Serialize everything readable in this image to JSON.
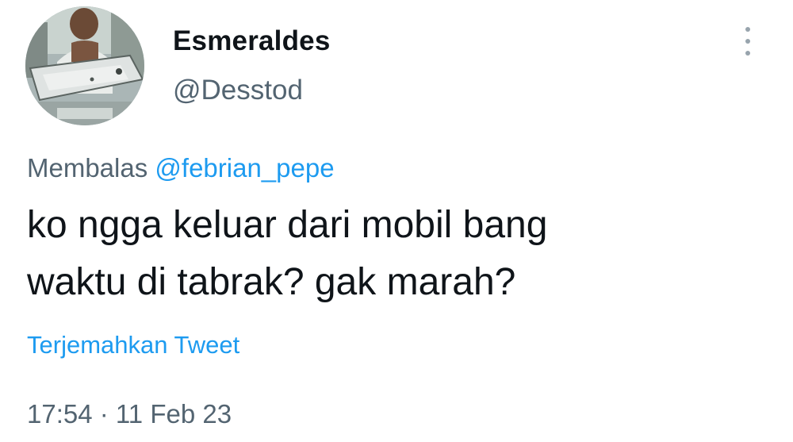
{
  "author": {
    "display_name": "Esmeraldes",
    "handle": "@Desstod",
    "avatar_icon": "profile-photo"
  },
  "more_icon": "more-vertical-icon",
  "reply": {
    "prefix": "Membalas",
    "mention": "@febrian_pepe"
  },
  "tweet": {
    "lines": [
      "ko ngga keluar dari mobil bang",
      "waktu di tabrak? gak marah?"
    ]
  },
  "translate_label": "Terjemahkan Tweet",
  "timestamp": "17:54 · 11 Feb 23",
  "colors": {
    "text": "#0f1419",
    "secondary": "#536471",
    "link": "#1d9bf0"
  }
}
